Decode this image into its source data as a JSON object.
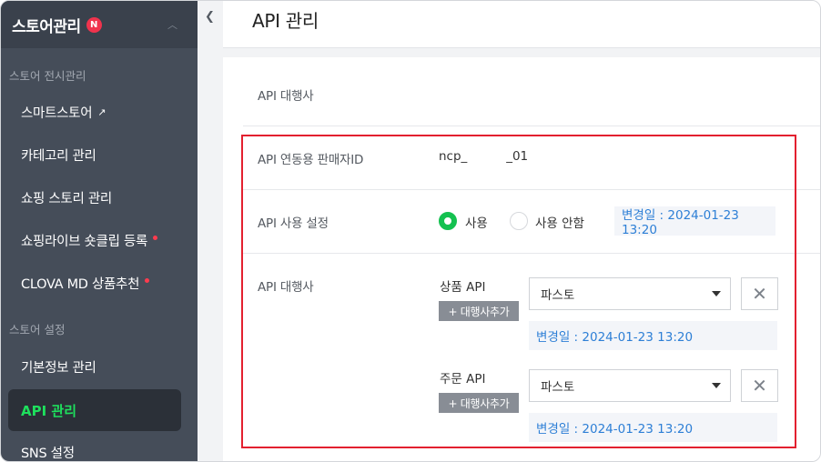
{
  "sidebar": {
    "title": "스토어관리",
    "badge": "N",
    "section1": "스토어 전시관리",
    "items1": [
      {
        "label": "스마트스토어",
        "icon": "external-link-icon"
      },
      {
        "label": "카테고리 관리"
      },
      {
        "label": "쇼핑 스토리 관리"
      },
      {
        "label": "쇼핑라이브 숏클립 등록",
        "new_dot": true
      },
      {
        "label": "CLOVA MD 상품추천",
        "new_dot": true
      }
    ],
    "section2": "스토어 설정",
    "items2": [
      {
        "label": "기본정보 관리"
      },
      {
        "label": "API 관리",
        "active": true
      },
      {
        "label": "SNS 설정"
      }
    ]
  },
  "header": {
    "title": "API 관리"
  },
  "form": {
    "agency_label": "API 대행사",
    "seller_id_label": "API 연동용 판매자ID",
    "seller_id_value": "ncp_          _01",
    "usage_label": "API 사용 설정",
    "usage_on": "사용",
    "usage_off": "사용 안함",
    "usage_changed": "변경일 : 2024-01-23 13:20",
    "agency2_label": "API 대행사",
    "product_api_label": "상품 API",
    "product_add_btn": "+ 대행사추가",
    "product_select": "파스토",
    "product_changed": "변경일 : 2024-01-23 13:20",
    "order_api_label": "주문 API",
    "order_add_btn": "+ 대행사추가",
    "order_select": "파스토",
    "order_changed": "변경일 : 2024-01-23 13:20"
  },
  "colors": {
    "sidebar_bg": "#454d59",
    "active_green": "#1ee05d",
    "radio_green": "#14c150",
    "highlight_red": "#e3202f",
    "date_blue": "#2d7fd6"
  }
}
